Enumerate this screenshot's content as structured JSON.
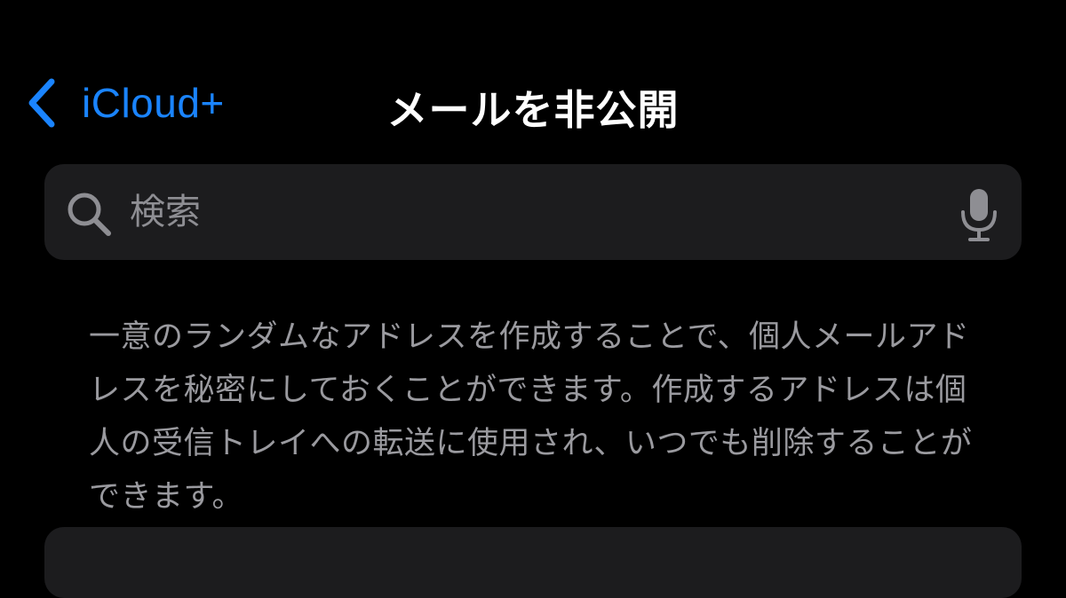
{
  "nav": {
    "back_label": "iCloud+",
    "title": "メールを非公開"
  },
  "search": {
    "placeholder": "検索",
    "value": ""
  },
  "description": {
    "text": "一意のランダムなアドレスを作成することで、個人メールアドレスを秘密にしておくことができます。作成するアドレスは個人の受信トレイへの転送に使用され、いつでも削除することができます。"
  },
  "icons": {
    "back": "chevron-left-icon",
    "search": "magnifying-glass-icon",
    "mic": "microphone-icon"
  },
  "colors": {
    "background": "#000000",
    "accent": "#1a84ff",
    "card": "#1c1c1e",
    "secondary_text": "#9a9a9f",
    "placeholder": "#8e8e93"
  }
}
